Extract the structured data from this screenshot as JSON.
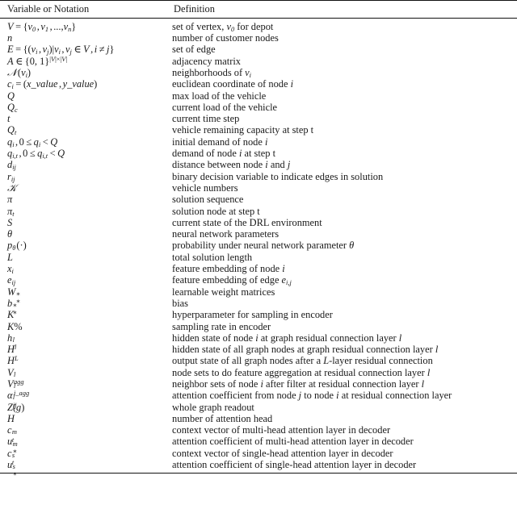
{
  "table": {
    "headers": {
      "notation": "Variable or Notation",
      "definition": "Definition"
    },
    "rows": [
      {
        "notation": "V = {v0, v1, ..., vn}",
        "definition_plain": "set of vertex, v0 for depot",
        "definition": "set of vertex,  for depot"
      },
      {
        "notation": "n",
        "definition": "number of customer nodes"
      },
      {
        "notation": "E = {(vi, vj)|vi, vj ∈ V, i ≠ j}",
        "definition": "set of edge"
      },
      {
        "notation": "A ∈ {0, 1}^{|V|×|V|}",
        "definition": "adjacency matrix"
      },
      {
        "notation": "ℕ(vi)",
        "definition_plain": "neighborhoods of vi",
        "definition": "neighborhoods of "
      },
      {
        "notation": "ci = (x_value, y_value)",
        "definition_plain": "euclidean coordinate of node i",
        "definition": "euclidean coordinate of node "
      },
      {
        "notation": "Q",
        "definition": "max load of the vehicle"
      },
      {
        "notation": "Qc",
        "definition": "current load of the vehicle"
      },
      {
        "notation": "t",
        "definition": "current time step"
      },
      {
        "notation": "Qt",
        "definition": "vehicle remaining capacity at step t"
      },
      {
        "notation": "qi, 0 ≤ qi < Q",
        "definition_plain": "initial demand of node i",
        "definition": "initial demand of node "
      },
      {
        "notation": "qi,t, 0 ≤ qi,t < Q",
        "definition_plain": "demand of node i at step t",
        "definition": "demand of node  at step t"
      },
      {
        "notation": "dij",
        "definition_plain": "distance between node i and j",
        "definition": "distance between node  and "
      },
      {
        "notation": "rij",
        "definition": "binary decision variable to indicate edges in solution"
      },
      {
        "notation": "𝒦",
        "definition": "vehicle numbers"
      },
      {
        "notation": "π",
        "definition": "solution sequence"
      },
      {
        "notation": "πt",
        "definition": "solution node at step t"
      },
      {
        "notation": "S",
        "definition": "current state of the DRL environment"
      },
      {
        "notation": "θ",
        "definition": "neural network parameters"
      },
      {
        "notation": "pθ(·)",
        "definition_plain": "probability under neural network parameter θ",
        "definition": "probability under neural network parameter "
      },
      {
        "notation": "L",
        "definition": "total solution length"
      },
      {
        "notation": "xi",
        "definition_plain": "feature embedding of node i",
        "definition": "feature embedding of node "
      },
      {
        "notation": "eij",
        "definition_plain": "feature embedding of edge ei,j",
        "definition": "feature embedding of edge "
      },
      {
        "notation": "W*^*",
        "definition": "learnable weight matrices"
      },
      {
        "notation": "b*^*",
        "definition": "bias"
      },
      {
        "notation": "K",
        "definition": "hyperparameter for sampling in encoder"
      },
      {
        "notation": "K%",
        "definition": "sampling rate in encoder"
      },
      {
        "notation": "hi^l",
        "definition_plain": "hidden state of node i at graph residual connection layer l",
        "definition": "hidden state of node  at graph residual connection layer "
      },
      {
        "notation": "H^l",
        "definition_plain": "hidden state of all graph nodes at graph residual connection layer l",
        "definition": "hidden state of all graph nodes at graph residual connection layer "
      },
      {
        "notation": "H^L",
        "definition_plain": "output state of all graph nodes after a L-layer residual connection",
        "definition": "output state of all graph nodes after a -layer residual connection"
      },
      {
        "notation": "V_agg^l",
        "definition_plain": "node sets to do feature aggregation at residual connection layer l",
        "definition": "node sets to do feature aggregation at residual connection layer "
      },
      {
        "notation": "V_i_agg^l",
        "definition_plain": "neighbor sets of node i after filter at residual connection layer l",
        "definition": "neighbor sets of node  after filter at residual connection layer "
      },
      {
        "notation": "αij^l",
        "definition_plain": "attention coefficient from node j to node i at residual connection layer",
        "definition": "attention coefficient from node  to node  at residual connection layer"
      },
      {
        "notation": "Z(g)",
        "definition": "whole graph readout"
      },
      {
        "notation": "H",
        "definition": "number of attention head"
      },
      {
        "notation": "ct^m",
        "definition": "context vector of multi-head attention layer in decoder"
      },
      {
        "notation": "u*^m",
        "definition": "attention coefficient of multi-head attention layer in decoder"
      },
      {
        "notation": "ct^s",
        "definition": "context vector of single-head attention layer in decoder"
      },
      {
        "notation": "u*^s",
        "definition": "attention coefficient of single-head attention layer in decoder"
      }
    ]
  }
}
